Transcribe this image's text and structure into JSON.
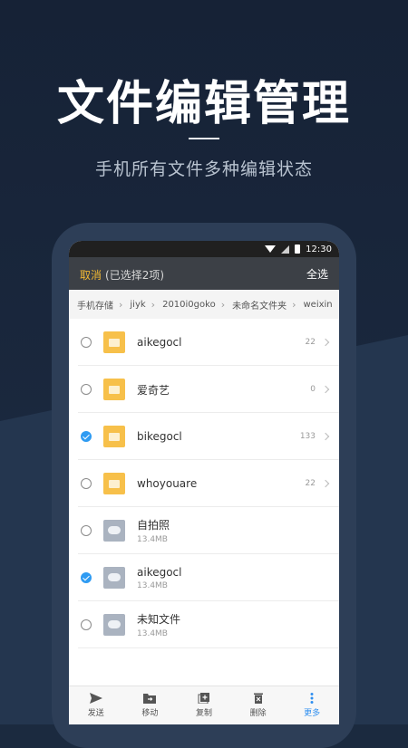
{
  "promo": {
    "headline": "文件编辑管理",
    "subheadline": "手机所有文件多种编辑状态"
  },
  "status_bar": {
    "time": "12:30"
  },
  "app_bar": {
    "cancel_label": "取消",
    "selection_info": "(已选择2项)",
    "select_all_label": "全选"
  },
  "breadcrumb": [
    "手机存储",
    "jiyk",
    "2010i0goko",
    "未命名文件夹",
    "weixin"
  ],
  "files": [
    {
      "name": "aikegocl",
      "type": "folder",
      "count": "22",
      "checked": false
    },
    {
      "name": "爱奇艺",
      "type": "folder",
      "count": "0",
      "checked": false
    },
    {
      "name": "bikegocl",
      "type": "folder",
      "count": "133",
      "checked": true
    },
    {
      "name": "whoyouare",
      "type": "folder",
      "count": "22",
      "checked": false
    },
    {
      "name": "自拍照",
      "type": "file",
      "size": "13.4MB",
      "checked": false
    },
    {
      "name": "aikegocl",
      "type": "file",
      "size": "13.4MB",
      "checked": true
    },
    {
      "name": "未知文件",
      "type": "file",
      "size": "13.4MB",
      "checked": false
    }
  ],
  "actions": [
    {
      "label": "发送",
      "icon": "send-icon"
    },
    {
      "label": "移动",
      "icon": "move-icon"
    },
    {
      "label": "复制",
      "icon": "copy-icon"
    },
    {
      "label": "删除",
      "icon": "delete-icon"
    },
    {
      "label": "更多",
      "icon": "more-icon"
    }
  ],
  "colors": {
    "accent": "#f2b933",
    "check": "#2f9bf2",
    "folder": "#f7c04a",
    "background": "#1b2a3f"
  }
}
